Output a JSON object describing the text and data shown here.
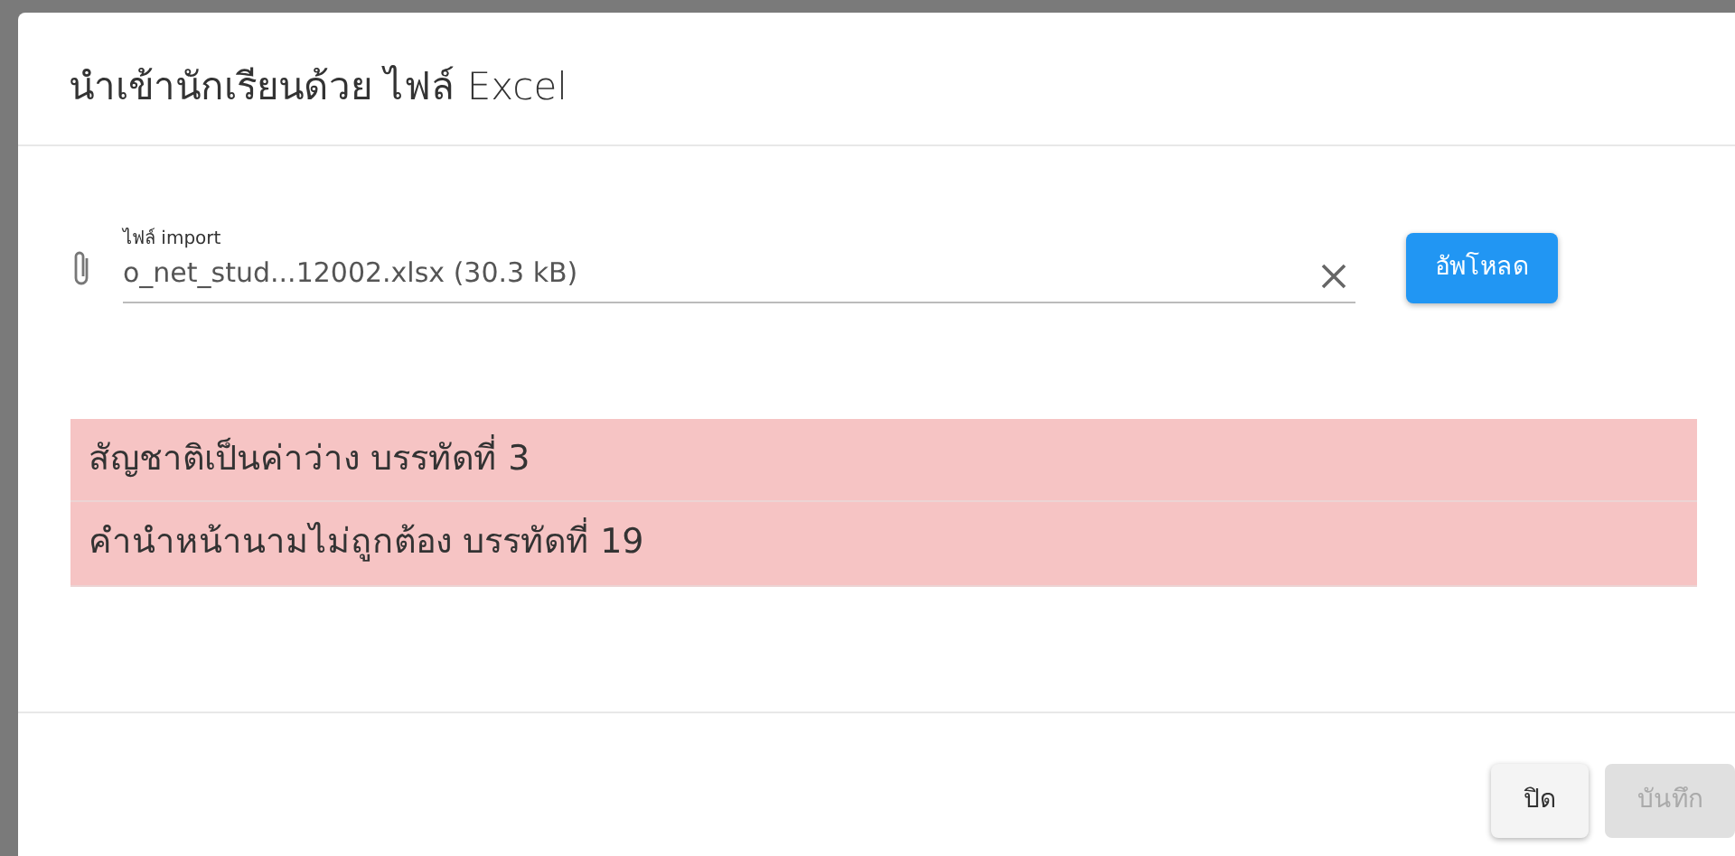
{
  "dialog": {
    "title": "นำเข้านักเรียนด้วย ไฟล์ Excel"
  },
  "file_field": {
    "label": "ไฟล์ import",
    "value": "o_net_stud...12002.xlsx (30.3 kB)"
  },
  "upload_button": {
    "label": "อัพโหลด",
    "disabled": false
  },
  "errors": [
    {
      "text": "สัญชาติเป็นค่าว่าง บรรทัดที่ 3"
    },
    {
      "text": "คำนำหน้านามไม่ถูกต้อง บรรทัดที่ 19"
    }
  ],
  "buttons": [
    {
      "label": "ปิด",
      "disabled": false
    },
    {
      "label": "บันทึก",
      "disabled": true
    }
  ]
}
